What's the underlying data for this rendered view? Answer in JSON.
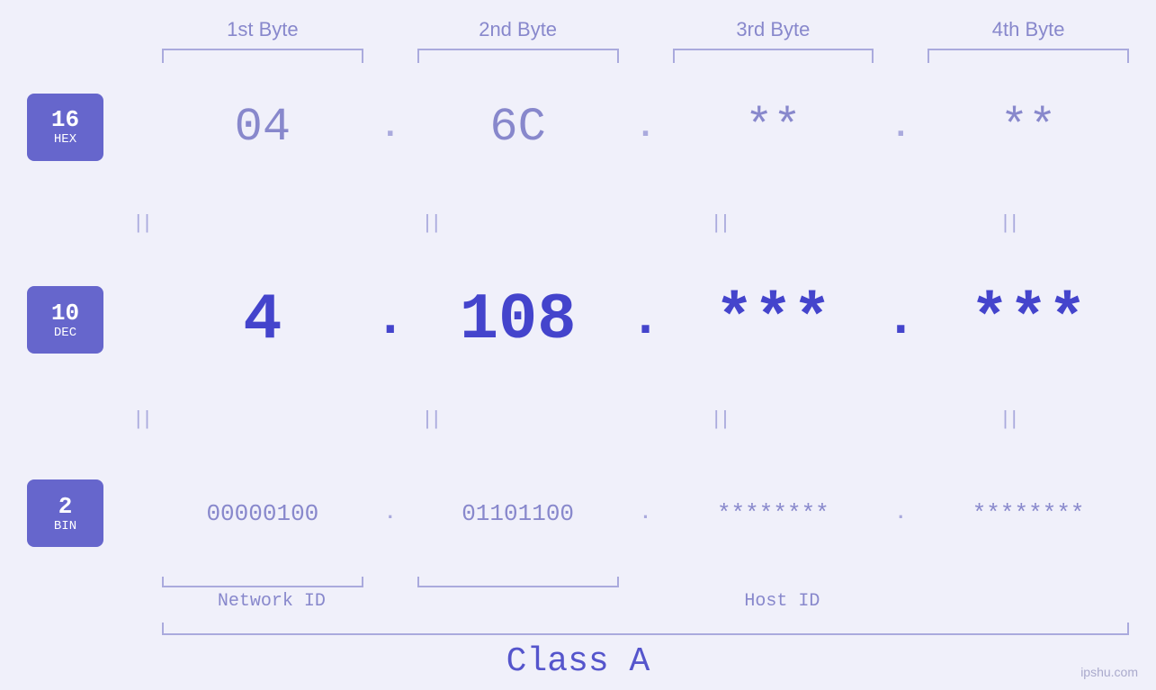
{
  "header": {
    "byte1": "1st Byte",
    "byte2": "2nd Byte",
    "byte3": "3rd Byte",
    "byte4": "4th Byte"
  },
  "badges": {
    "hex": {
      "number": "16",
      "label": "HEX"
    },
    "dec": {
      "number": "10",
      "label": "DEC"
    },
    "bin": {
      "number": "2",
      "label": "BIN"
    }
  },
  "hex_row": {
    "b1": "04",
    "b2": "6C",
    "b3": "**",
    "b4": "**",
    "dot": "."
  },
  "dec_row": {
    "b1": "4",
    "b2": "108",
    "b3": "***",
    "b4": "***",
    "dot": "."
  },
  "bin_row": {
    "b1": "00000100",
    "b2": "01101100",
    "b3": "********",
    "b4": "********",
    "dot": "."
  },
  "labels": {
    "network_id": "Network ID",
    "host_id": "Host ID",
    "class": "Class A"
  },
  "equals": "||",
  "watermark": "ipshu.com"
}
